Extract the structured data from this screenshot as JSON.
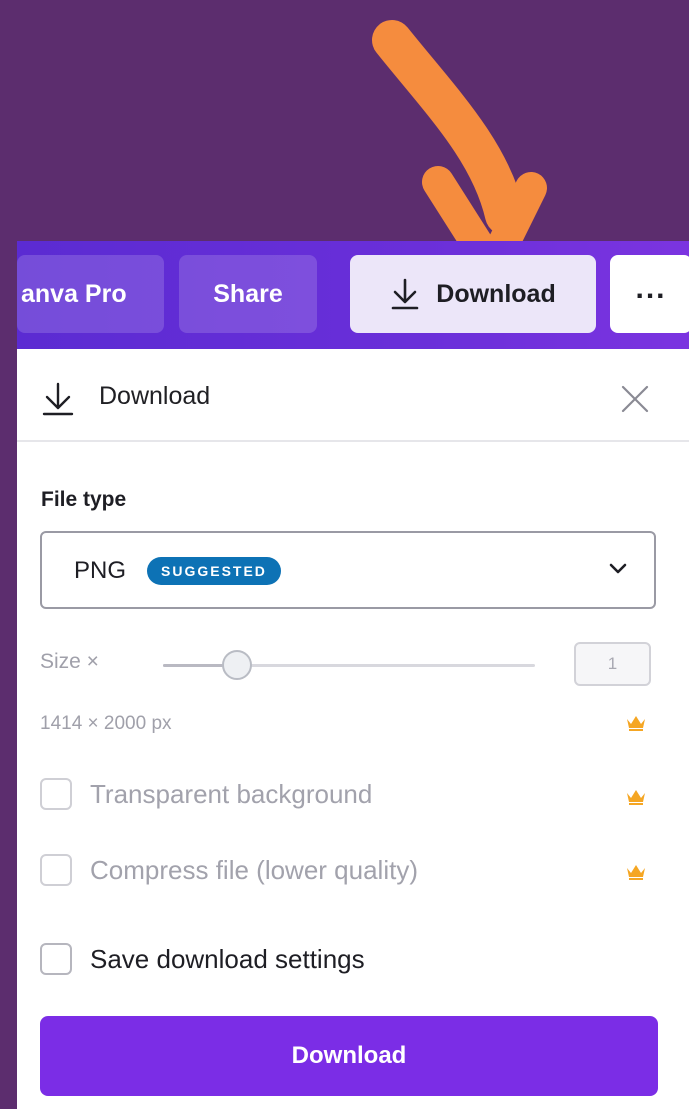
{
  "toolbar": {
    "pro_label": "anva Pro",
    "share_label": "Share",
    "download_label": "Download",
    "more_label": "...",
    "download_icon": "download-icon",
    "more_icon": "more-icon"
  },
  "annotation": {
    "icon": "arrow-pointer-icon",
    "color": "#f58c3e"
  },
  "panel": {
    "title": "Download",
    "title_icon": "download-icon",
    "close_icon": "close-icon",
    "file_type_label": "File type",
    "file_type_value": "PNG",
    "file_type_badge": "SUGGESTED",
    "size_label": "Size ×",
    "size_value": "1",
    "size_slider_fraction": 0.2,
    "dimensions": "1414 × 2000 px",
    "premium_icon": "crown-icon",
    "options": [
      {
        "label": "Transparent background",
        "checked": false,
        "premium": true
      },
      {
        "label": "Compress file (lower quality)",
        "checked": false,
        "premium": true
      },
      {
        "label": "Save download settings",
        "checked": false,
        "premium": false
      }
    ],
    "download_button": "Download"
  },
  "colors": {
    "background": "#5c2d6e",
    "toolbar": "#6a2fd9",
    "primary_button": "#7b2de6",
    "badge": "#0d72b5",
    "crown": "#f5a623",
    "arrow": "#f58c3e"
  }
}
